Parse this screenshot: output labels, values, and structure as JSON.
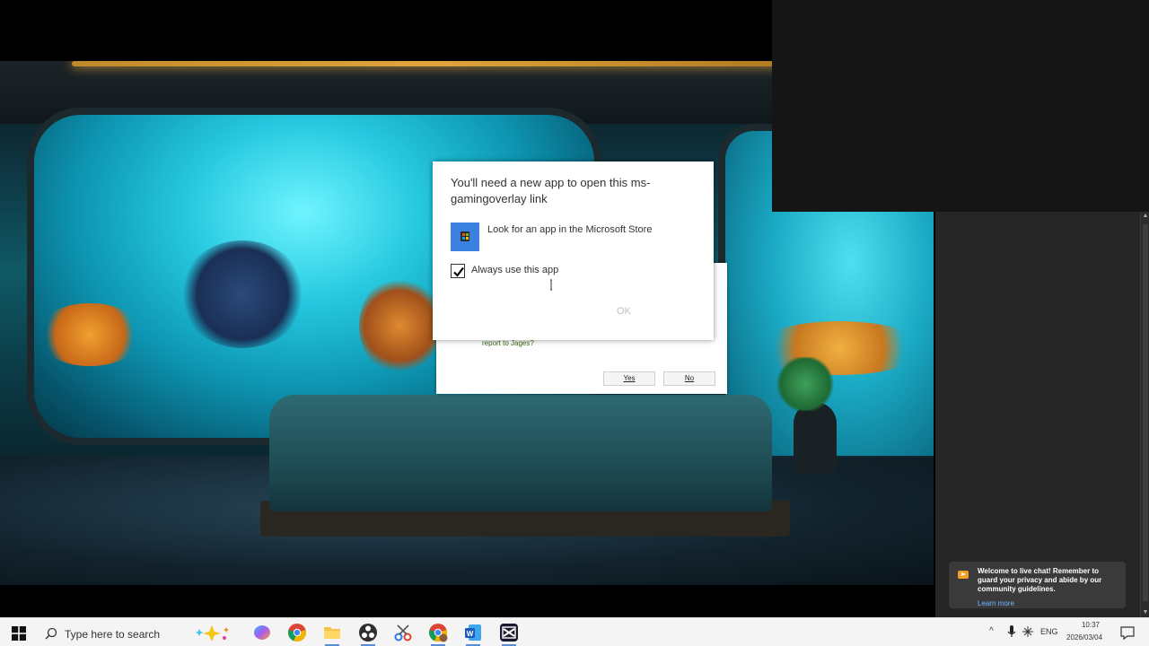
{
  "dialog": {
    "title": "You'll need a new app to open this ms-gamingoverlay link",
    "store_option": "Look for an app in the Microsoft Store",
    "always_use": "Always use this app",
    "always_use_checked": true,
    "ok_label": "OK"
  },
  "background_dialog": {
    "report_text": "report to Jages?",
    "yes_label": "Yes",
    "no_label": "No"
  },
  "chat_toast": {
    "message": "Welcome to live chat! Remember to guard your privacy and abide by our community guidelines.",
    "link": "Learn more"
  },
  "taskbar": {
    "search_placeholder": "Type here to search",
    "apps": [
      {
        "name": "copilot-icon"
      },
      {
        "name": "chrome-icon"
      },
      {
        "name": "file-explorer-icon"
      },
      {
        "name": "obs-icon"
      },
      {
        "name": "snipping-tool-icon"
      },
      {
        "name": "chrome-profile-icon"
      },
      {
        "name": "word-icon"
      },
      {
        "name": "capcut-icon"
      }
    ],
    "tray": {
      "language": "ENG",
      "time": "10:37",
      "date": "2026/03/04"
    }
  },
  "colors": {
    "accent": "#3b82e0",
    "taskbar_bg": "#f4f4f4",
    "toast_bg": "#3a3a3a",
    "link": "#6fb3ff"
  }
}
